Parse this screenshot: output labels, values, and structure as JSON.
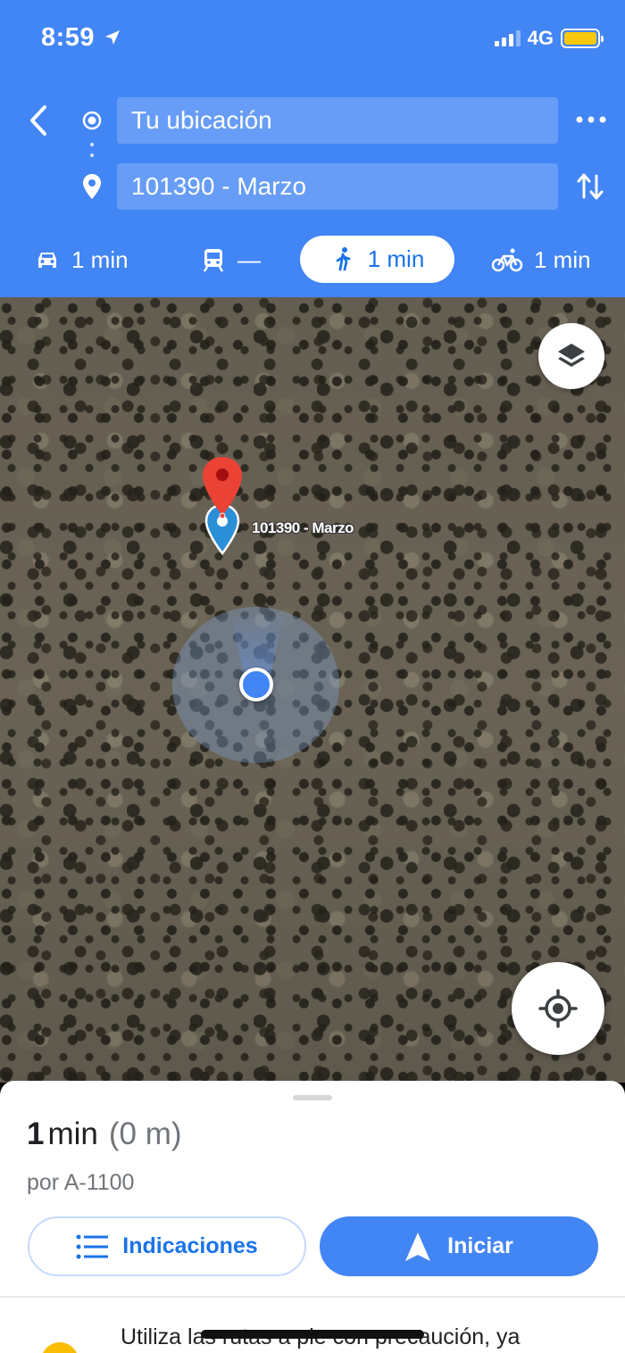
{
  "status_bar": {
    "time": "8:59",
    "network": "4G",
    "battery_level": 0.9
  },
  "directions": {
    "origin": "Tu ubicación",
    "destination": "101390 - Marzo"
  },
  "modes": [
    {
      "name": "drive",
      "icon": "car-icon",
      "label": "1 min",
      "selected": false
    },
    {
      "name": "transit",
      "icon": "train-icon",
      "label": "—",
      "selected": false
    },
    {
      "name": "walk",
      "icon": "walking-icon",
      "label": "1 min",
      "selected": true
    },
    {
      "name": "bike",
      "icon": "bicycle-icon",
      "label": "1 min",
      "selected": false
    }
  ],
  "map": {
    "view": "satellite",
    "destination_label": "101390 - Marzo"
  },
  "sheet": {
    "eta_value": "1",
    "eta_unit": "min",
    "distance": "(0 m)",
    "via": "por A-1100",
    "directions_button": "Indicaciones",
    "start_button": "Iniciar",
    "warning_text": "Utiliza las rutas a pie con precaución, ya"
  },
  "colors": {
    "header": "#4285f4",
    "accent": "#1a73e8",
    "pin_red": "#ea4335",
    "warning": "#fbbc04"
  }
}
